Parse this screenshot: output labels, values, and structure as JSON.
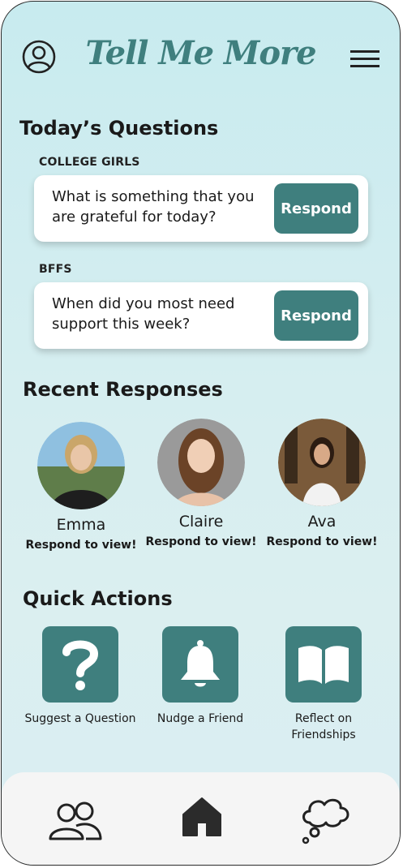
{
  "header": {
    "title": "Tell Me More"
  },
  "todays_questions": {
    "heading": "Today’s Questions",
    "groups": [
      {
        "label": "COLLEGE GIRLS",
        "question": "What is something that you are grateful for today?",
        "button": "Respond"
      },
      {
        "label": "BFFS",
        "question": "When did you most need support this week?",
        "button": "Respond"
      }
    ]
  },
  "recent_responses": {
    "heading": "Recent Responses",
    "people": [
      {
        "name": "Emma",
        "status": "Respond to view!"
      },
      {
        "name": "Claire",
        "status": "Respond to view!"
      },
      {
        "name": "Ava",
        "status": "Respond to view!"
      }
    ]
  },
  "quick_actions": {
    "heading": "Quick Actions",
    "items": [
      {
        "label": "Suggest a Question",
        "icon": "question-mark-icon"
      },
      {
        "label": "Nudge a Friend",
        "icon": "bell-icon"
      },
      {
        "label": "Reflect on Friendships",
        "icon": "open-book-icon"
      }
    ]
  },
  "bottom_nav": {
    "items": [
      {
        "icon": "friends-icon"
      },
      {
        "icon": "home-icon"
      },
      {
        "icon": "thought-bubble-icon"
      }
    ]
  },
  "colors": {
    "accent": "#3f7f7e",
    "background_top": "#c8ebef",
    "background_bottom": "#d9eef3"
  }
}
